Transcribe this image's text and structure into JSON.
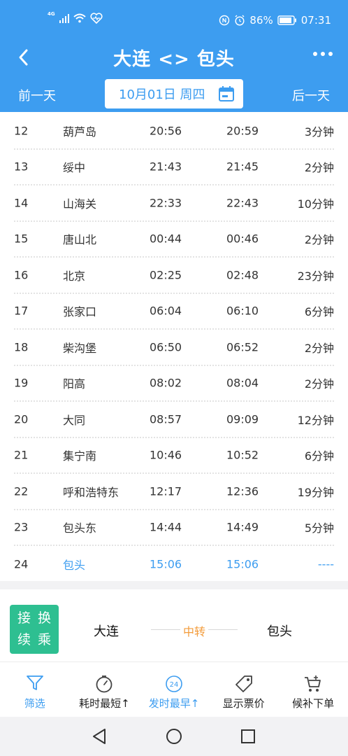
{
  "status_bar": {
    "network": "4G",
    "battery": "86%",
    "time": "07:31"
  },
  "header": {
    "title": "大连 <> 包头",
    "prev_day": "前一天",
    "next_day": "后一天",
    "date": "10月01日 周四"
  },
  "stops": [
    {
      "no": "12",
      "name": "葫芦岛",
      "arrive": "20:56",
      "depart": "20:59",
      "stay": "3分钟"
    },
    {
      "no": "13",
      "name": "绥中",
      "arrive": "21:43",
      "depart": "21:45",
      "stay": "2分钟"
    },
    {
      "no": "14",
      "name": "山海关",
      "arrive": "22:33",
      "depart": "22:43",
      "stay": "10分钟"
    },
    {
      "no": "15",
      "name": "唐山北",
      "arrive": "00:44",
      "depart": "00:46",
      "stay": "2分钟"
    },
    {
      "no": "16",
      "name": "北京",
      "arrive": "02:25",
      "depart": "02:48",
      "stay": "23分钟"
    },
    {
      "no": "17",
      "name": "张家口",
      "arrive": "06:04",
      "depart": "06:10",
      "stay": "6分钟"
    },
    {
      "no": "18",
      "name": "柴沟堡",
      "arrive": "06:50",
      "depart": "06:52",
      "stay": "2分钟"
    },
    {
      "no": "19",
      "name": "阳高",
      "arrive": "08:02",
      "depart": "08:04",
      "stay": "2分钟"
    },
    {
      "no": "20",
      "name": "大同",
      "arrive": "08:57",
      "depart": "09:09",
      "stay": "12分钟"
    },
    {
      "no": "21",
      "name": "集宁南",
      "arrive": "10:46",
      "depart": "10:52",
      "stay": "6分钟"
    },
    {
      "no": "22",
      "name": "呼和浩特东",
      "arrive": "12:17",
      "depart": "12:36",
      "stay": "19分钟"
    },
    {
      "no": "23",
      "name": "包头东",
      "arrive": "14:44",
      "depart": "14:49",
      "stay": "5分钟"
    },
    {
      "no": "24",
      "name": "包头",
      "arrive": "15:06",
      "depart": "15:06",
      "stay": "----"
    }
  ],
  "transfer": {
    "badge": [
      "接",
      "换",
      "续",
      "乘"
    ],
    "from": "大连",
    "middle": "中转",
    "to": "包头"
  },
  "toolbar": [
    {
      "label": "筛选",
      "icon": "filter-icon",
      "active": true
    },
    {
      "label": "耗时最短↑",
      "icon": "timer-icon",
      "active": false
    },
    {
      "label": "发时最早↑",
      "icon": "clock-24-icon",
      "active": true,
      "icon_text": "24"
    },
    {
      "label": "显示票价",
      "icon": "price-tag-icon",
      "active": false
    },
    {
      "label": "候补下单",
      "icon": "cart-add-icon",
      "active": false
    }
  ],
  "colors": {
    "primary": "#3d9df0",
    "transfer_badge": "#2ebf91",
    "transfer_label": "#f39c3c"
  }
}
